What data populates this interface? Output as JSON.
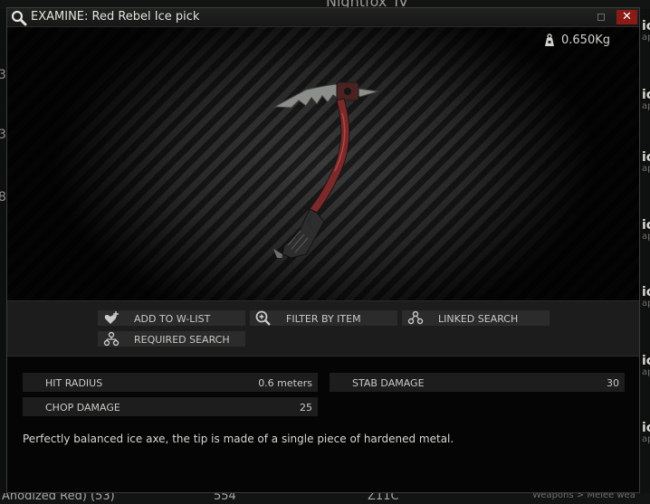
{
  "window": {
    "title": "EXAMINE: Red Rebel Ice pick",
    "close_label": "✕"
  },
  "item": {
    "weight": "0.650Kg",
    "description": "Perfectly balanced ice axe, the tip is made of a single piece of hardened metal."
  },
  "actions": {
    "add_to_wlist": "ADD TO W-LIST",
    "filter_by_item": "FILTER BY ITEM",
    "linked_search": "LINKED SEARCH",
    "required_search": "REQUIRED SEARCH"
  },
  "stats": [
    {
      "label": "HIT RADIUS",
      "value": "0.6 meters"
    },
    {
      "label": "STAB DAMAGE",
      "value": "30"
    },
    {
      "label": "CHOP DAMAGE",
      "value": "25"
    }
  ],
  "background": {
    "top_tab_text": "Nightfox_IV",
    "bottom_texts": [
      "Anodized Red) (53)",
      "554",
      "Z11C",
      "Weapons > Melee wea"
    ],
    "left_digits": [
      "3",
      "3",
      "8"
    ],
    "right_labels": [
      "ic",
      "ap"
    ]
  },
  "colors": {
    "close_button": "#8a1a16",
    "handle_red": "#7a2a2a",
    "panel_bg": "#1b1c1b"
  }
}
